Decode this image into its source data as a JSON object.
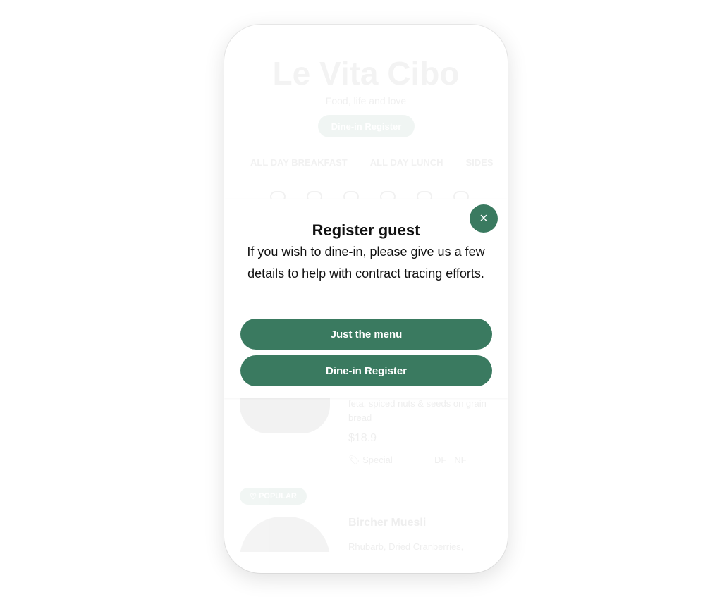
{
  "background": {
    "restaurant_name": "Le Vita Cibo",
    "tagline": "Food, life and love",
    "register_pill": "Dine-in Register",
    "categories": [
      "ALL DAY BREAKFAST",
      "ALL DAY LUNCH",
      "SIDES"
    ],
    "dish1": {
      "description": "feta, spiced nuts & seeds on grain bread",
      "price": "$18.9",
      "tag": "Special",
      "diet1": "DF",
      "diet2": "NF"
    },
    "popular_badge": "POPULAR",
    "dish2": {
      "name": "Bircher Muesli",
      "description": "Rhubarb, Dried Cranberries,"
    }
  },
  "modal": {
    "title": "Register guest",
    "message": "If you wish to dine-in, please give us a few details to help with contract tracing efforts.",
    "menu_button": "Just the menu",
    "register_button": "Dine-in Register",
    "close_symbol": "×"
  },
  "colors": {
    "accent": "#3a7a60"
  }
}
